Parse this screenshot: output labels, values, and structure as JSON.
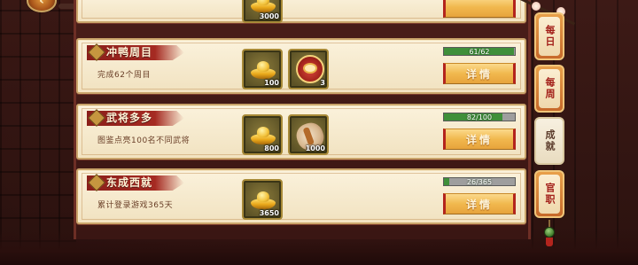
{
  "colors": {
    "accent_red": "#a52a22",
    "progress_green": "#3f8f3a",
    "card_bg": "#f6ead0",
    "button_gold": "#f1b84e"
  },
  "top_card": {
    "reward_count": "3000"
  },
  "cards": [
    {
      "title": "冲鸭周目",
      "description": "完成62个周目",
      "rewards": [
        {
          "icon": "gold-ingot-icon",
          "count": "100"
        },
        {
          "icon": "red-mascot-icon",
          "count": "3"
        }
      ],
      "progress_text": "61/62",
      "progress_value": 0.984,
      "button_label": "详情"
    },
    {
      "title": "武将多多",
      "description": "图鉴点亮100名不同武将",
      "rewards": [
        {
          "icon": "gold-ingot-icon",
          "count": "800"
        },
        {
          "icon": "scroll-icon",
          "count": "1000"
        }
      ],
      "progress_text": "82/100",
      "progress_value": 0.82,
      "button_label": "详情"
    },
    {
      "title": "东成西就",
      "description": "累计登录游戏365天",
      "rewards": [
        {
          "icon": "gold-ingot-icon",
          "count": "3650"
        }
      ],
      "progress_text": "26/365",
      "progress_value": 0.071,
      "button_label": "详情"
    }
  ],
  "tabs": [
    {
      "label": "每日",
      "active": false
    },
    {
      "label": "每周",
      "active": false
    },
    {
      "label": "成就",
      "active": true
    },
    {
      "label": "官职",
      "active": false
    }
  ]
}
